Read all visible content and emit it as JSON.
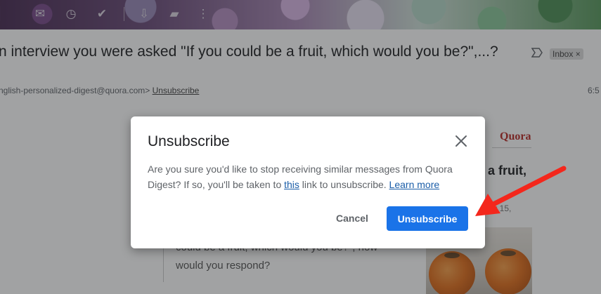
{
  "toolbar": {
    "icons": [
      "archive-icon",
      "mark-unread-icon",
      "snooze-icon",
      "add-task-icon",
      "move-to-icon",
      "label-icon",
      "more-vert-icon"
    ]
  },
  "email": {
    "subject": "n interview you were asked \"If you could be a fruit, which would you be?\",...?",
    "chip_label": "Inbox",
    "chip_close": "×",
    "sender": "nglish-personalized-digest@quora.com>",
    "sender_unsubscribe": "Unsubscribe",
    "time": "6:5",
    "brand": "Quora",
    "headline_fragment": "a fruit,",
    "date_fragment": "ber 15,",
    "quote_line1": "could be a fruit, which would you be?\", how",
    "quote_line2": "would you respond?"
  },
  "dialog": {
    "title": "Unsubscribe",
    "body_part1": "Are you sure you'd like to stop receiving similar messages from Quora Digest? If so, you'll be taken to ",
    "body_link": "this",
    "body_part2": " link to unsubscribe. ",
    "learn_more": "Learn more",
    "cancel_label": "Cancel",
    "confirm_label": "Unsubscribe"
  },
  "colors": {
    "primary_button": "#1a73e8",
    "link": "#1a5da8",
    "quora_brand": "#b92b27",
    "annotation_arrow": "#f4271c"
  }
}
